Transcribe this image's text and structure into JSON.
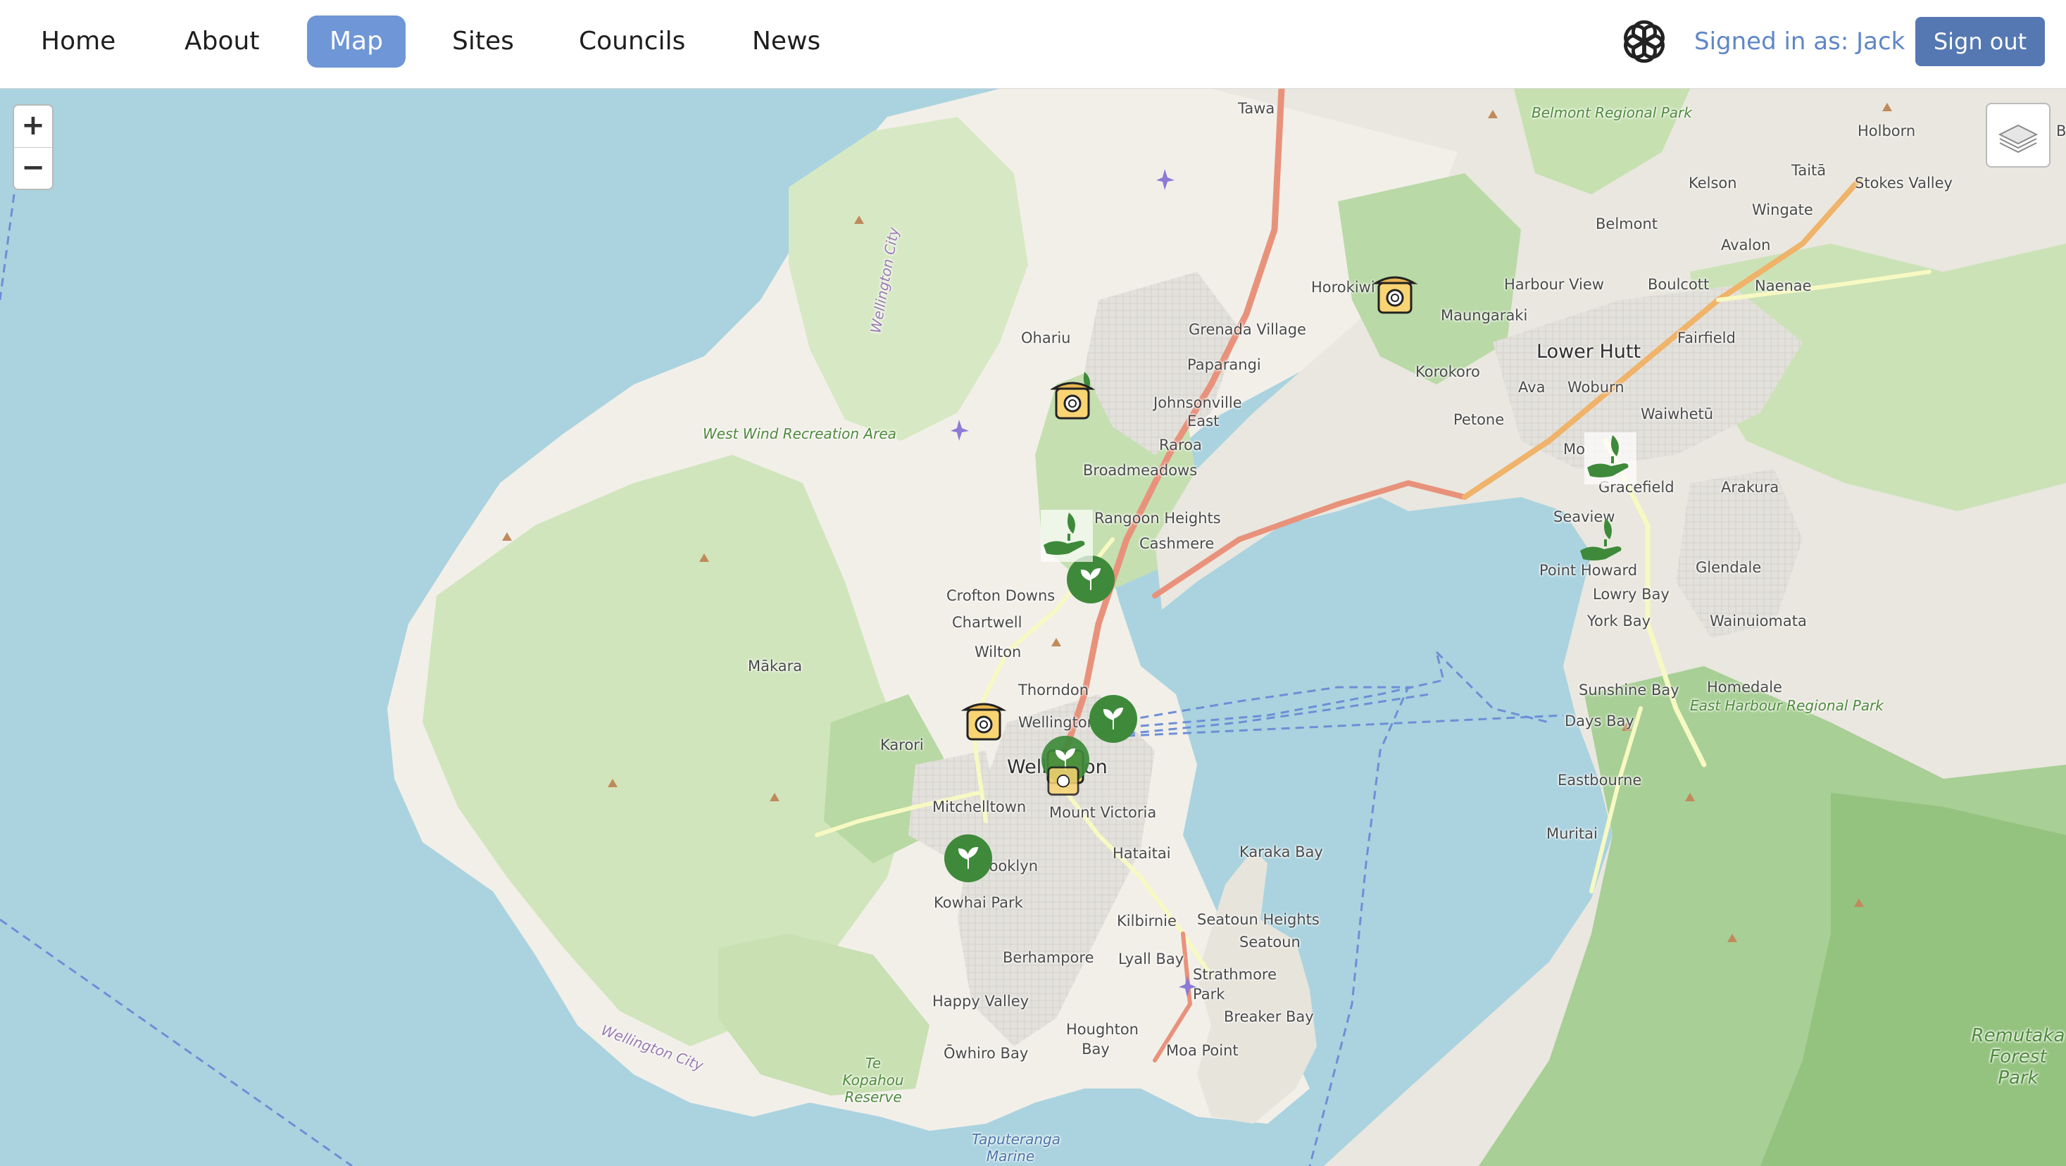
{
  "nav": {
    "items": [
      "Home",
      "About",
      "Map",
      "Sites",
      "Councils",
      "News"
    ],
    "active": "Map",
    "brand_icon": "openai-logo-icon",
    "signed_in_text": "Signed in as: Jack",
    "signout_label": "Sign out"
  },
  "map": {
    "zoom_in_label": "+",
    "zoom_out_label": "−",
    "layers_icon": "layers-icon",
    "places": {
      "tawa": "Tawa",
      "belmont_park": "Belmont Regional Park",
      "holborn": "Holborn",
      "b_edge": "B",
      "kelson": "Kelson",
      "taita": "Taitā",
      "stokes_valley": "Stokes Valley",
      "wingate": "Wingate",
      "belmont": "Belmont",
      "avalon": "Avalon",
      "horokiwi": "Horokiwi",
      "harbour_view": "Harbour View",
      "boulcott": "Boulcott",
      "naenae": "Naenae",
      "grenada_village": "Grenada Village",
      "maungaraki": "Maungaraki",
      "ohariu": "Ohariu",
      "paparangi": "Paparangi",
      "fairfield": "Fairfield",
      "lower_hutt": "Lower Hutt",
      "korokoro": "Korokoro",
      "ava": "Ava",
      "woburn": "Woburn",
      "johnsonville": "Johnsonville",
      "east": "East",
      "petone": "Petone",
      "waiwhetu": "Waiwhetū",
      "west_wind": "West Wind Recreation Area",
      "raroa": "Raroa",
      "mo": "Mo",
      "broadmeadows": "Broadmeadows",
      "gracefield": "Gracefield",
      "arakura": "Arakura",
      "rangoon_heights": "Rangoon Heights",
      "seaview": "Seaview",
      "cashmere": "Cashmere",
      "point_howard": "Point Howard",
      "glendale": "Glendale",
      "lowry_bay": "Lowry Bay",
      "crofton_downs": "Crofton Downs",
      "chartwell": "Chartwell",
      "york_bay": "York Bay",
      "wainuiomata": "Wainuiomata",
      "wilton": "Wilton",
      "makara": "Mākara",
      "homedale": "Homedale",
      "thorndon": "Thorndon",
      "sunshine_bay": "Sunshine Bay",
      "east_harbour_park": "East Harbour Regional Park",
      "wellington_c": "Wellington C",
      "days_bay": "Days Bay",
      "karori": "Karori",
      "wellington": "Wellington",
      "eastbourne": "Eastbourne",
      "mitchelltown": "Mitchelltown",
      "mount_victoria": "Mount Victoria",
      "muritai": "Muritai",
      "hataitai": "Hataitai",
      "karaka_bay": "Karaka Bay",
      "brooklyn": "Brooklyn",
      "kowhai_park": "Kowhai Park",
      "seatoun_heights": "Seatoun Heights",
      "seatoun": "Seatoun",
      "kilbirnie": "Kilbirnie",
      "berhampore": "Berhampore",
      "lyall_bay": "Lyall Bay",
      "strathmore_park": "Strathmore Park",
      "happy_valley": "Happy Valley",
      "breaker_bay": "Breaker Bay",
      "houghton_bay": "Houghton Bay",
      "moa_point": "Moa Point",
      "owhiro_bay": "Ōwhiro Bay",
      "te_kopahou": "Te Kopahou Reserve",
      "taputeranga": "Taputeranga Marine",
      "remutaka": "Remutaka Forest Park",
      "wellington_city_1": "Wellington City",
      "wellington_city_2": "Wellington City"
    },
    "markers": [
      {
        "type": "compost-bin-icon"
      },
      {
        "type": "compost-bin-icon"
      },
      {
        "type": "seedling-circle-icon"
      },
      {
        "type": "compost-bin-icon"
      },
      {
        "type": "seedling-circle-icon"
      },
      {
        "type": "seedling-circle-icon"
      },
      {
        "type": "seedling-circle-icon"
      },
      {
        "type": "hand-plant-icon"
      },
      {
        "type": "hand-plant-icon"
      },
      {
        "type": "hand-plant-icon"
      },
      {
        "type": "compost-bin-icon"
      }
    ],
    "colors": {
      "water": "#aad3df",
      "land": "#f2efe9",
      "park": "#cde3b8",
      "forest": "#a9d09a",
      "road_major": "#e8927c",
      "road_minor": "#f7f9c2",
      "marker_green": "#3e8a3a",
      "marker_yellow": "#f8d472"
    }
  }
}
